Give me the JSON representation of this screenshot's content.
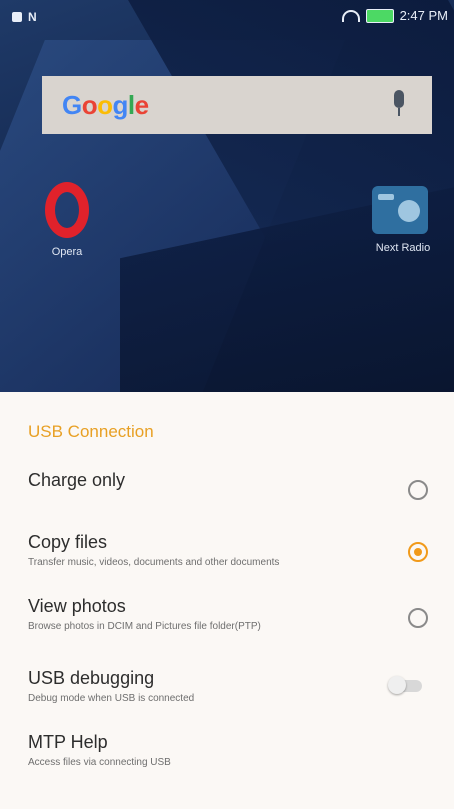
{
  "status_bar": {
    "time": "2:47 PM"
  },
  "home": {
    "search": {
      "logo": "Google",
      "logo_colors": [
        "#4285f4",
        "#ea4335",
        "#fbbc05",
        "#4285f4",
        "#34a853",
        "#ea4335"
      ],
      "mic_icon": "mic-icon"
    },
    "apps": [
      {
        "label": "Opera",
        "icon": "opera-icon"
      },
      {
        "label": "Next Radio",
        "icon": "radio-icon"
      }
    ]
  },
  "usb_sheet": {
    "title": "USB Connection",
    "accent": "#f19a1a",
    "options": [
      {
        "label": "Charge only",
        "sub": "",
        "selected": false
      },
      {
        "label": "Copy files",
        "sub": "Transfer music, videos, documents and other documents",
        "selected": true
      },
      {
        "label": "View photos",
        "sub": "Browse photos in DCIM and Pictures file folder(PTP)",
        "selected": false
      }
    ],
    "usb_debugging": {
      "label": "USB debugging",
      "sub": "Debug mode when USB is connected",
      "enabled": false
    },
    "mtp_help": {
      "label": "MTP Help",
      "sub": "Access files via connecting USB"
    }
  }
}
